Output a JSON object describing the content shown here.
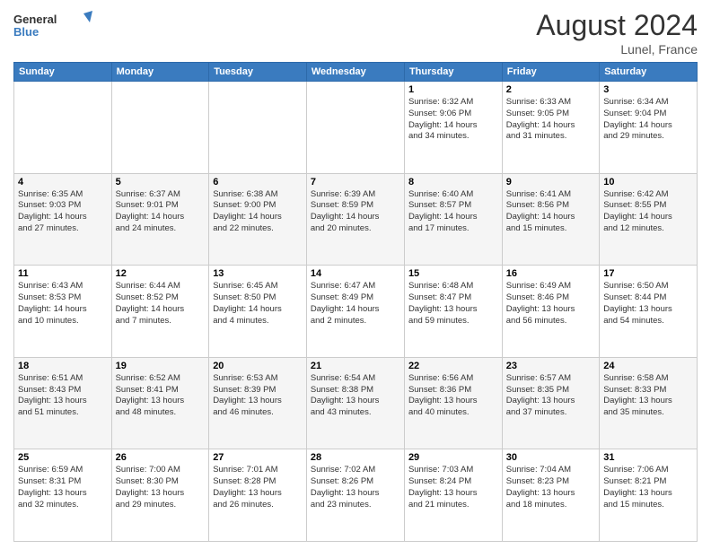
{
  "header": {
    "logo_general": "General",
    "logo_blue": "Blue",
    "month_year": "August 2024",
    "location": "Lunel, France"
  },
  "days_of_week": [
    "Sunday",
    "Monday",
    "Tuesday",
    "Wednesday",
    "Thursday",
    "Friday",
    "Saturday"
  ],
  "weeks": [
    [
      {
        "day": "",
        "info": ""
      },
      {
        "day": "",
        "info": ""
      },
      {
        "day": "",
        "info": ""
      },
      {
        "day": "",
        "info": ""
      },
      {
        "day": "1",
        "info": "Sunrise: 6:32 AM\nSunset: 9:06 PM\nDaylight: 14 hours\nand 34 minutes."
      },
      {
        "day": "2",
        "info": "Sunrise: 6:33 AM\nSunset: 9:05 PM\nDaylight: 14 hours\nand 31 minutes."
      },
      {
        "day": "3",
        "info": "Sunrise: 6:34 AM\nSunset: 9:04 PM\nDaylight: 14 hours\nand 29 minutes."
      }
    ],
    [
      {
        "day": "4",
        "info": "Sunrise: 6:35 AM\nSunset: 9:03 PM\nDaylight: 14 hours\nand 27 minutes."
      },
      {
        "day": "5",
        "info": "Sunrise: 6:37 AM\nSunset: 9:01 PM\nDaylight: 14 hours\nand 24 minutes."
      },
      {
        "day": "6",
        "info": "Sunrise: 6:38 AM\nSunset: 9:00 PM\nDaylight: 14 hours\nand 22 minutes."
      },
      {
        "day": "7",
        "info": "Sunrise: 6:39 AM\nSunset: 8:59 PM\nDaylight: 14 hours\nand 20 minutes."
      },
      {
        "day": "8",
        "info": "Sunrise: 6:40 AM\nSunset: 8:57 PM\nDaylight: 14 hours\nand 17 minutes."
      },
      {
        "day": "9",
        "info": "Sunrise: 6:41 AM\nSunset: 8:56 PM\nDaylight: 14 hours\nand 15 minutes."
      },
      {
        "day": "10",
        "info": "Sunrise: 6:42 AM\nSunset: 8:55 PM\nDaylight: 14 hours\nand 12 minutes."
      }
    ],
    [
      {
        "day": "11",
        "info": "Sunrise: 6:43 AM\nSunset: 8:53 PM\nDaylight: 14 hours\nand 10 minutes."
      },
      {
        "day": "12",
        "info": "Sunrise: 6:44 AM\nSunset: 8:52 PM\nDaylight: 14 hours\nand 7 minutes."
      },
      {
        "day": "13",
        "info": "Sunrise: 6:45 AM\nSunset: 8:50 PM\nDaylight: 14 hours\nand 4 minutes."
      },
      {
        "day": "14",
        "info": "Sunrise: 6:47 AM\nSunset: 8:49 PM\nDaylight: 14 hours\nand 2 minutes."
      },
      {
        "day": "15",
        "info": "Sunrise: 6:48 AM\nSunset: 8:47 PM\nDaylight: 13 hours\nand 59 minutes."
      },
      {
        "day": "16",
        "info": "Sunrise: 6:49 AM\nSunset: 8:46 PM\nDaylight: 13 hours\nand 56 minutes."
      },
      {
        "day": "17",
        "info": "Sunrise: 6:50 AM\nSunset: 8:44 PM\nDaylight: 13 hours\nand 54 minutes."
      }
    ],
    [
      {
        "day": "18",
        "info": "Sunrise: 6:51 AM\nSunset: 8:43 PM\nDaylight: 13 hours\nand 51 minutes."
      },
      {
        "day": "19",
        "info": "Sunrise: 6:52 AM\nSunset: 8:41 PM\nDaylight: 13 hours\nand 48 minutes."
      },
      {
        "day": "20",
        "info": "Sunrise: 6:53 AM\nSunset: 8:39 PM\nDaylight: 13 hours\nand 46 minutes."
      },
      {
        "day": "21",
        "info": "Sunrise: 6:54 AM\nSunset: 8:38 PM\nDaylight: 13 hours\nand 43 minutes."
      },
      {
        "day": "22",
        "info": "Sunrise: 6:56 AM\nSunset: 8:36 PM\nDaylight: 13 hours\nand 40 minutes."
      },
      {
        "day": "23",
        "info": "Sunrise: 6:57 AM\nSunset: 8:35 PM\nDaylight: 13 hours\nand 37 minutes."
      },
      {
        "day": "24",
        "info": "Sunrise: 6:58 AM\nSunset: 8:33 PM\nDaylight: 13 hours\nand 35 minutes."
      }
    ],
    [
      {
        "day": "25",
        "info": "Sunrise: 6:59 AM\nSunset: 8:31 PM\nDaylight: 13 hours\nand 32 minutes."
      },
      {
        "day": "26",
        "info": "Sunrise: 7:00 AM\nSunset: 8:30 PM\nDaylight: 13 hours\nand 29 minutes."
      },
      {
        "day": "27",
        "info": "Sunrise: 7:01 AM\nSunset: 8:28 PM\nDaylight: 13 hours\nand 26 minutes."
      },
      {
        "day": "28",
        "info": "Sunrise: 7:02 AM\nSunset: 8:26 PM\nDaylight: 13 hours\nand 23 minutes."
      },
      {
        "day": "29",
        "info": "Sunrise: 7:03 AM\nSunset: 8:24 PM\nDaylight: 13 hours\nand 21 minutes."
      },
      {
        "day": "30",
        "info": "Sunrise: 7:04 AM\nSunset: 8:23 PM\nDaylight: 13 hours\nand 18 minutes."
      },
      {
        "day": "31",
        "info": "Sunrise: 7:06 AM\nSunset: 8:21 PM\nDaylight: 13 hours\nand 15 minutes."
      }
    ]
  ]
}
